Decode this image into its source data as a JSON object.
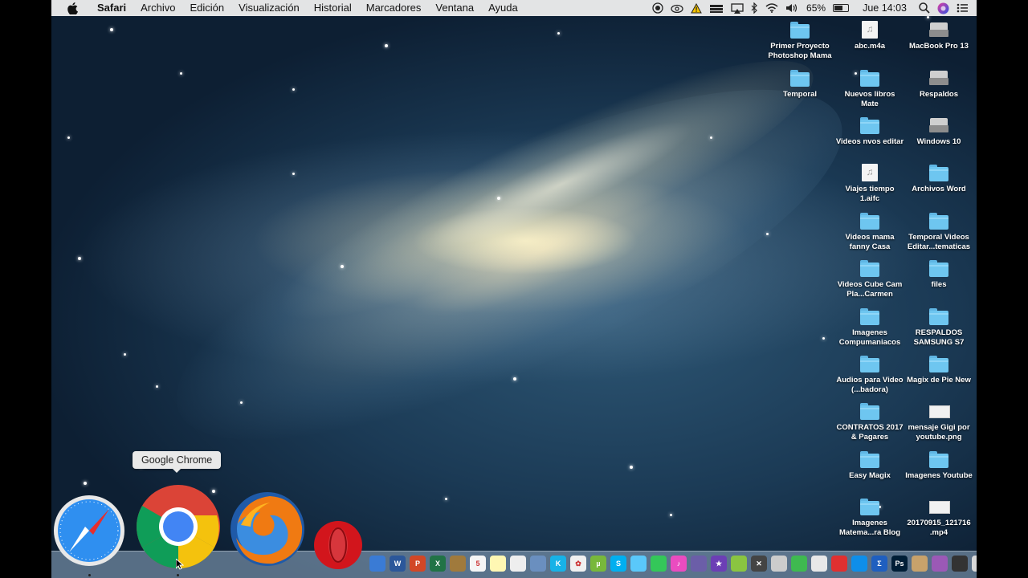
{
  "menubar": {
    "app_name": "Safari",
    "menus": [
      "Archivo",
      "Edición",
      "Visualización",
      "Historial",
      "Marcadores",
      "Ventana",
      "Ayuda"
    ],
    "status": {
      "battery": "65%",
      "battery_level": 0.65,
      "clock": "Jue 14:03",
      "icons": [
        "record-icon",
        "creative-cloud-icon",
        "warning-icon",
        "drive-icon",
        "airplay-icon",
        "bluetooth-icon",
        "wifi-icon",
        "volume-icon",
        "battery-icon",
        "spotlight-icon",
        "siri-icon",
        "notification-center-icon"
      ]
    }
  },
  "desktop_icons": [
    {
      "label": "Primer Proyecto Photoshop Mama",
      "kind": "folder"
    },
    {
      "label": "abc.m4a",
      "kind": "audio"
    },
    {
      "label": "MacBook Pro 13",
      "kind": "drive"
    },
    {
      "label": "Temporal",
      "kind": "folder"
    },
    {
      "label": "Nuevos libros Mate",
      "kind": "folder"
    },
    {
      "label": "Respaldos",
      "kind": "drive"
    },
    {
      "label": "Videos nvos editar",
      "kind": "folder"
    },
    {
      "label": "Windows 10",
      "kind": "drive"
    },
    {
      "label": "Viajes tiempo 1.aifc",
      "kind": "audio"
    },
    {
      "label": "Archivos Word",
      "kind": "folder"
    },
    {
      "label": "Videos mama fanny Casa",
      "kind": "folder"
    },
    {
      "label": "Temporal Videos Editar...tematicas",
      "kind": "folder"
    },
    {
      "label": "Videos Cube Cam Pla...Carmen",
      "kind": "folder"
    },
    {
      "label": "files",
      "kind": "folder"
    },
    {
      "label": "Imagenes Compumaniacos",
      "kind": "folder"
    },
    {
      "label": "RESPALDOS SAMSUNG S7",
      "kind": "folder"
    },
    {
      "label": "Audios para Video (...badora)",
      "kind": "folder"
    },
    {
      "label": "Magix de Pie New",
      "kind": "folder"
    },
    {
      "label": "CONTRATOS 2017 & Pagares",
      "kind": "folder"
    },
    {
      "label": "mensaje Gigi por youtube.png",
      "kind": "image"
    },
    {
      "label": "Easy Magix",
      "kind": "folder"
    },
    {
      "label": "Imagenes Youtube",
      "kind": "folder"
    },
    {
      "label": "Imagenes Matema...ra Blog",
      "kind": "folder"
    },
    {
      "label": "20170915_121716 .mp4",
      "kind": "video"
    }
  ],
  "dock": {
    "tooltip": "Google Chrome",
    "magnified_apps": [
      "Safari",
      "Google Chrome",
      "Firefox",
      "Opera"
    ],
    "small_apps": [
      {
        "name": "preview-icon",
        "color": "#3a7bd5",
        "glyph": ""
      },
      {
        "name": "word-icon",
        "color": "#2b579a",
        "glyph": "W"
      },
      {
        "name": "powerpoint-icon",
        "color": "#d24726",
        "glyph": "P"
      },
      {
        "name": "excel-icon",
        "color": "#217346",
        "glyph": "X"
      },
      {
        "name": "notebook-icon",
        "color": "#a07a3c",
        "glyph": ""
      },
      {
        "name": "calendar-icon",
        "color": "#f5f5f5",
        "glyph": "5"
      },
      {
        "name": "notes-icon",
        "color": "#fff7b3",
        "glyph": ""
      },
      {
        "name": "textedit-icon",
        "color": "#eeeeee",
        "glyph": ""
      },
      {
        "name": "image-capture-icon",
        "color": "#6a8fbf",
        "glyph": ""
      },
      {
        "name": "kodi-icon",
        "color": "#17b2e7",
        "glyph": "K"
      },
      {
        "name": "photos-icon",
        "color": "#f0f0f0",
        "glyph": "✿"
      },
      {
        "name": "utorrent-icon",
        "color": "#78b83b",
        "glyph": "µ"
      },
      {
        "name": "skype-icon",
        "color": "#00aff0",
        "glyph": "S"
      },
      {
        "name": "messages-icon",
        "color": "#5ac8fa",
        "glyph": ""
      },
      {
        "name": "facetime-icon",
        "color": "#34c759",
        "glyph": ""
      },
      {
        "name": "itunes-icon",
        "color": "#ea4cc0",
        "glyph": "♪"
      },
      {
        "name": "imovie-icon",
        "color": "#6b5ea8",
        "glyph": ""
      },
      {
        "name": "star-app-icon",
        "color": "#6c3fb5",
        "glyph": "★"
      },
      {
        "name": "bluestacks-icon",
        "color": "#8ac541",
        "glyph": ""
      },
      {
        "name": "crossover-icon",
        "color": "#444444",
        "glyph": "✕"
      },
      {
        "name": "automator-icon",
        "color": "#cccccc",
        "glyph": ""
      },
      {
        "name": "numbers-icon",
        "color": "#3fb950",
        "glyph": ""
      },
      {
        "name": "archive-icon",
        "color": "#e8e8e8",
        "glyph": ""
      },
      {
        "name": "snapz-icon",
        "color": "#e03030",
        "glyph": ""
      },
      {
        "name": "teamviewer-icon",
        "color": "#0e8ee9",
        "glyph": ""
      },
      {
        "name": "sigma-icon",
        "color": "#1f5fbf",
        "glyph": "Σ"
      },
      {
        "name": "photoshop-icon",
        "color": "#001e36",
        "glyph": "Ps"
      },
      {
        "name": "lightroom-icon",
        "color": "#c8a26b",
        "glyph": ""
      },
      {
        "name": "color-wheel-icon",
        "color": "#9b59b6",
        "glyph": ""
      },
      {
        "name": "dvd-player-icon",
        "color": "#333333",
        "glyph": ""
      },
      {
        "name": "screenshot-icon",
        "color": "#d9d9d9",
        "glyph": ""
      },
      {
        "name": "quicktime-icon",
        "color": "#1c6fb8",
        "glyph": ""
      }
    ]
  }
}
